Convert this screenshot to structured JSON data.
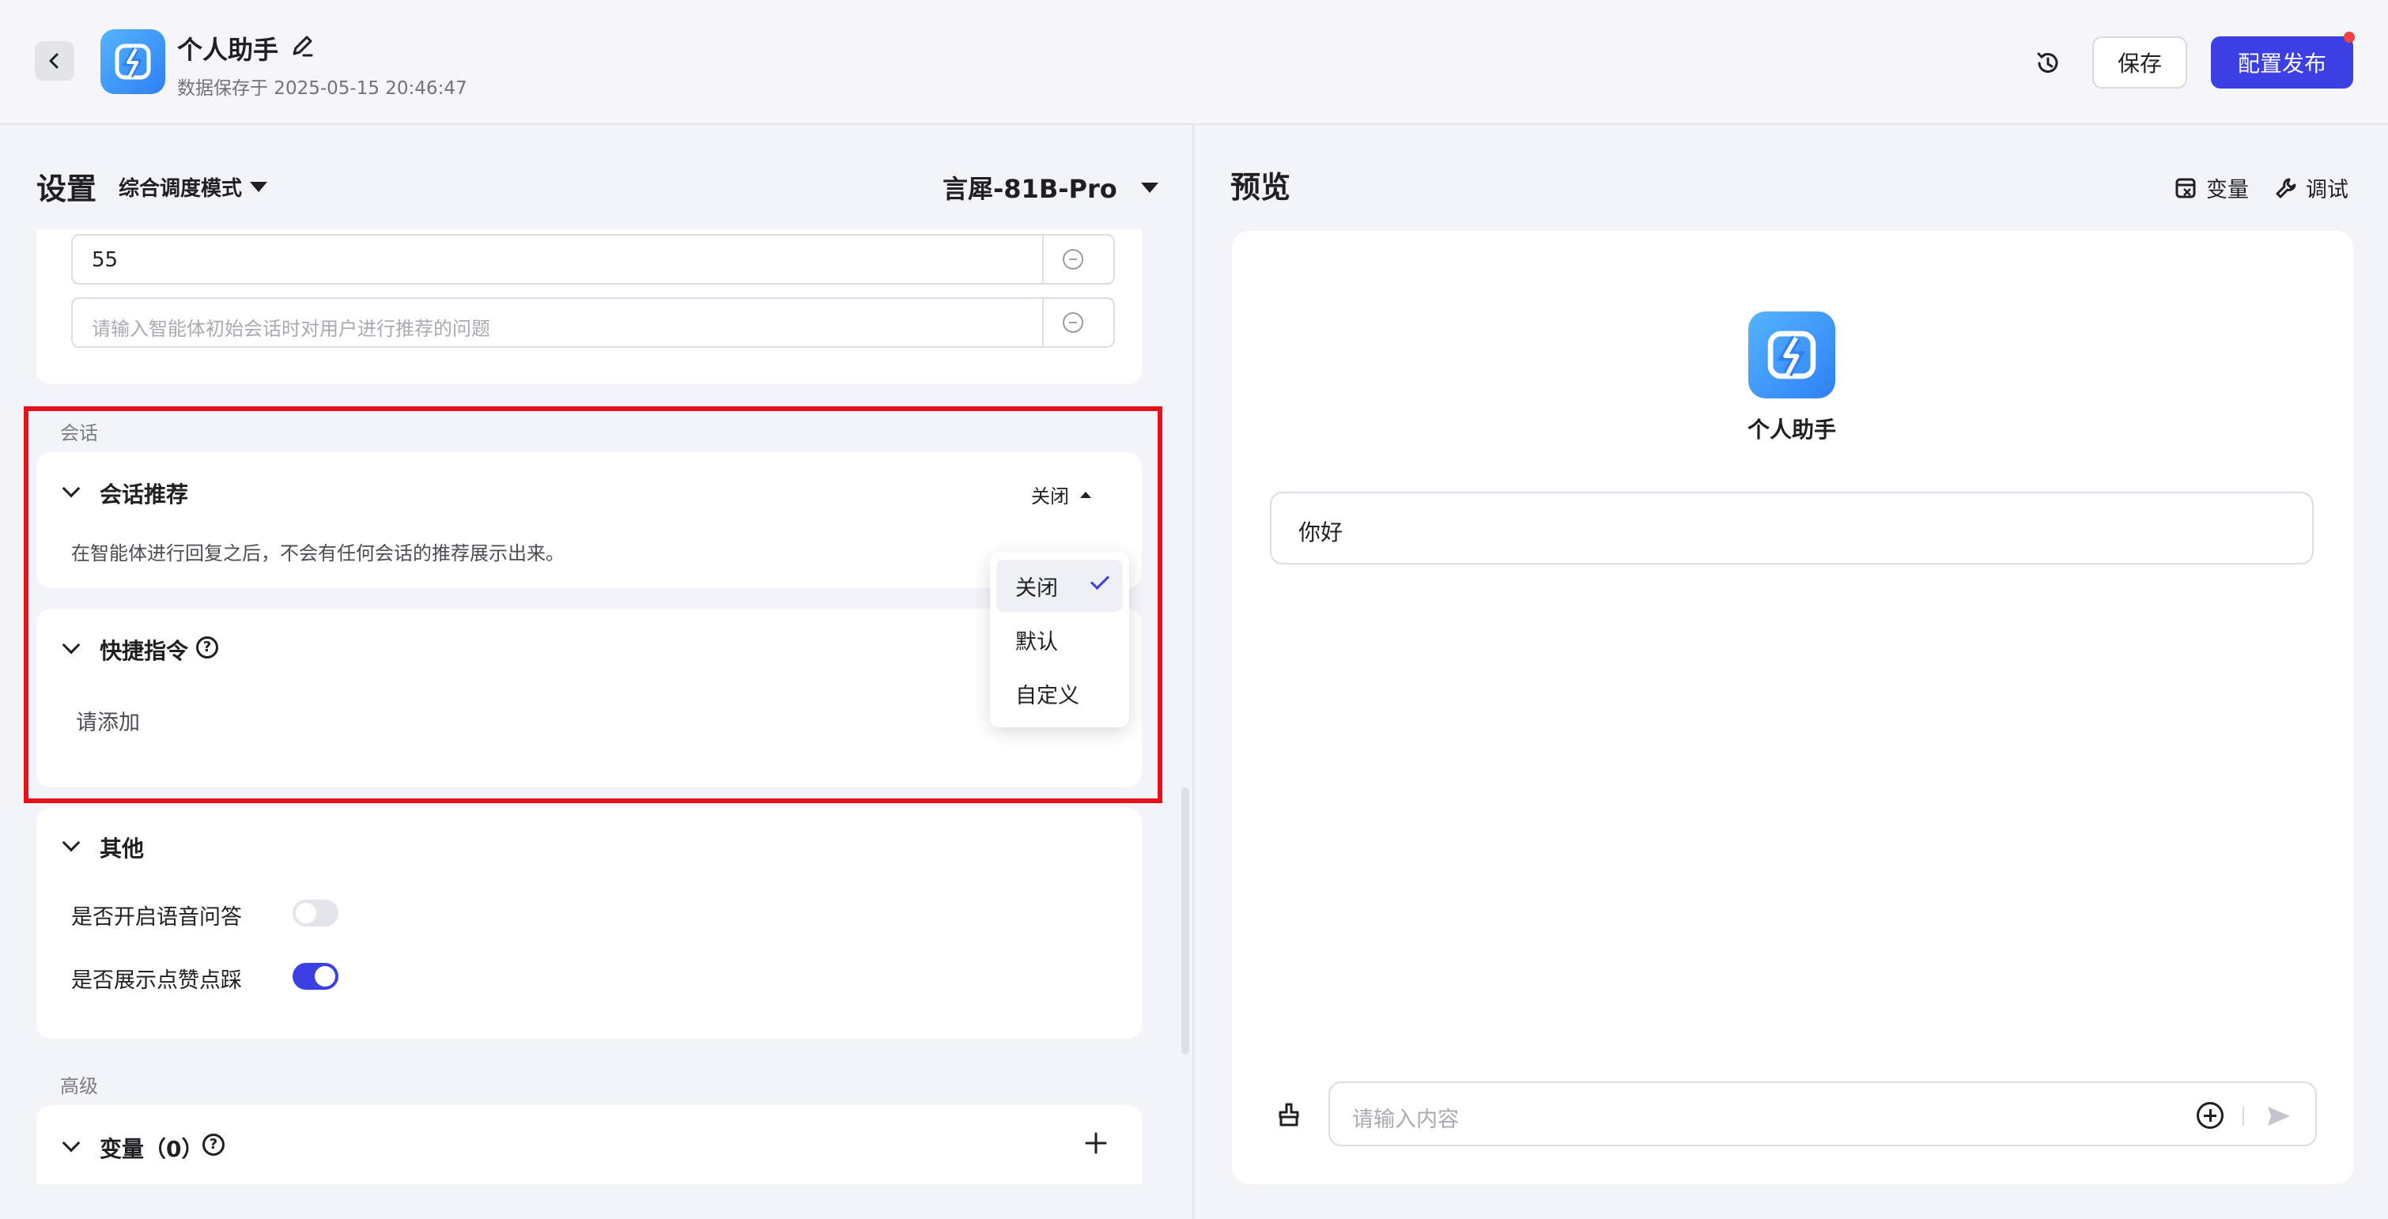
{
  "header": {
    "app_name": "个人助手",
    "save_time": "数据保存于 2025-05-15 20:46:47",
    "save_label": "保存",
    "publish_label": "配置发布"
  },
  "settings": {
    "title": "设置",
    "mode": "综合调度模式",
    "model": "言犀-81B-Pro",
    "questions": [
      {
        "value": "55"
      },
      {
        "placeholder": "请输入智能体初始会话时对用户进行推荐的问题"
      }
    ],
    "session_section": "会话",
    "recommend": {
      "title": "会话推荐",
      "status": "关闭",
      "desc": "在智能体进行回复之后，不会有任何会话的推荐展示出来。"
    },
    "dropdown_options": [
      {
        "label": "关闭",
        "selected": true
      },
      {
        "label": "默认",
        "selected": false
      },
      {
        "label": "自定义",
        "selected": false
      }
    ],
    "shortcut": {
      "title": "快捷指令",
      "help": "?",
      "empty": "请添加"
    },
    "other": {
      "title": "其他",
      "voice_label": "是否开启语音问答",
      "voice_on": false,
      "like_label": "是否展示点赞点踩",
      "like_on": true
    },
    "advanced_section": "高级",
    "variables": {
      "title": "变量（0）",
      "help": "?"
    }
  },
  "preview": {
    "title": "预览",
    "vars_label": "变量",
    "debug_label": "调试",
    "bot_name": "个人助手",
    "greeting": "你好",
    "input_placeholder": "请输入内容"
  },
  "colors": {
    "primary": "#3b3fe4",
    "highlight": "#e8101a",
    "logo_gradient_start": "#55b4ff",
    "logo_gradient_end": "#2f80f5"
  }
}
